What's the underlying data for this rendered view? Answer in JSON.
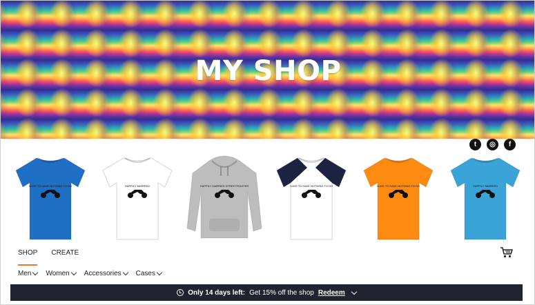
{
  "banner": {
    "title": "MY SHOP"
  },
  "social": [
    {
      "name": "twitter",
      "glyph": "t"
    },
    {
      "name": "instagram",
      "glyph": "◎"
    },
    {
      "name": "facebook",
      "glyph": "f"
    }
  ],
  "products": [
    {
      "type": "tshirt",
      "color": "#1f6fc5",
      "sleeve": "#1f6fc5",
      "print": "I LIKE TO HAVE NOTHING TO DO"
    },
    {
      "type": "tshirt",
      "color": "#ffffff",
      "sleeve": "#ffffff",
      "print": "HAPPILY MARRIED"
    },
    {
      "type": "hoodie",
      "color": "#bdbdbd",
      "sleeve": "#bdbdbd",
      "print": "HAPPILY MARRIED STREETFIGHTER"
    },
    {
      "type": "raglan",
      "color": "#ffffff",
      "sleeve": "#1b2340",
      "print": "I LIKE TO HAVE NOTHING TO DO"
    },
    {
      "type": "tshirt",
      "color": "#ff8a12",
      "sleeve": "#ff8a12",
      "print": "I LIKE TO HAVE NOTHING TO DO"
    },
    {
      "type": "tshirt",
      "color": "#3aa4d8",
      "sleeve": "#3aa4d8",
      "print": "HAPPILY MARRIED"
    }
  ],
  "nav": {
    "shop": "SHOP",
    "create": "CREATE"
  },
  "subnav": {
    "men": "Men",
    "women": "Women",
    "accessories": "Accessories",
    "cases": "Cases"
  },
  "promo": {
    "highlight": "Only 14 days left:",
    "text": "Get 15% off the shop",
    "redeem": "Redeem"
  },
  "colors": {
    "accent": "#e07a2b",
    "promo_bg": "#1f2430"
  }
}
